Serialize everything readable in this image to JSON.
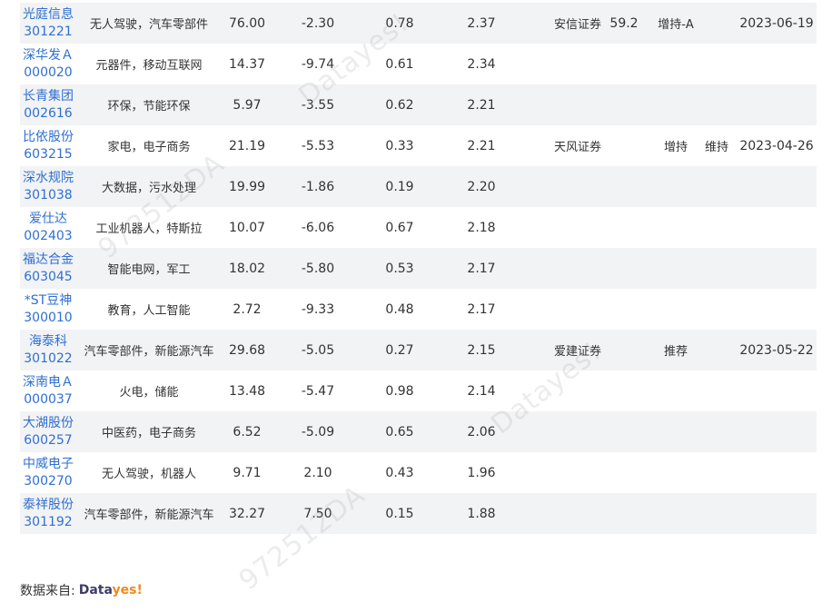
{
  "rows": [
    {
      "name": "光庭信息",
      "code": "301221",
      "industry": "无人驾驶，汽车零部件",
      "price": "76.00",
      "change": "-2.30",
      "turnover": "0.78",
      "vol_ratio": "2.37",
      "institution": "安信证券",
      "score": "59.2",
      "rating": "增持-A",
      "action": "",
      "date": "2023-06-19"
    },
    {
      "name": "深华发Ａ",
      "code": "000020",
      "industry": "元器件，移动互联网",
      "price": "14.37",
      "change": "-9.74",
      "turnover": "0.61",
      "vol_ratio": "2.34",
      "institution": "",
      "score": "",
      "rating": "",
      "action": "",
      "date": ""
    },
    {
      "name": "长青集团",
      "code": "002616",
      "industry": "环保，节能环保",
      "price": "5.97",
      "change": "-3.55",
      "turnover": "0.62",
      "vol_ratio": "2.21",
      "institution": "",
      "score": "",
      "rating": "",
      "action": "",
      "date": ""
    },
    {
      "name": "比依股份",
      "code": "603215",
      "industry": "家电，电子商务",
      "price": "21.19",
      "change": "-5.53",
      "turnover": "0.33",
      "vol_ratio": "2.21",
      "institution": "天风证券",
      "score": "",
      "rating": "增持",
      "action": "维持",
      "date": "2023-04-26"
    },
    {
      "name": "深水规院",
      "code": "301038",
      "industry": "大数据，污水处理",
      "price": "19.99",
      "change": "-1.86",
      "turnover": "0.19",
      "vol_ratio": "2.20",
      "institution": "",
      "score": "",
      "rating": "",
      "action": "",
      "date": ""
    },
    {
      "name": "爱仕达",
      "code": "002403",
      "industry": "工业机器人，特斯拉",
      "price": "10.07",
      "change": "-6.06",
      "turnover": "0.67",
      "vol_ratio": "2.18",
      "institution": "",
      "score": "",
      "rating": "",
      "action": "",
      "date": ""
    },
    {
      "name": "福达合金",
      "code": "603045",
      "industry": "智能电网，军工",
      "price": "18.02",
      "change": "-5.80",
      "turnover": "0.53",
      "vol_ratio": "2.17",
      "institution": "",
      "score": "",
      "rating": "",
      "action": "",
      "date": ""
    },
    {
      "name": "*ST豆神",
      "code": "300010",
      "industry": "教育，人工智能",
      "price": "2.72",
      "change": "-9.33",
      "turnover": "0.48",
      "vol_ratio": "2.17",
      "institution": "",
      "score": "",
      "rating": "",
      "action": "",
      "date": ""
    },
    {
      "name": "海泰科",
      "code": "301022",
      "industry": "汽车零部件，新能源汽车",
      "price": "29.68",
      "change": "-5.05",
      "turnover": "0.27",
      "vol_ratio": "2.15",
      "institution": "爱建证券",
      "score": "",
      "rating": "推荐",
      "action": "",
      "date": "2023-05-22"
    },
    {
      "name": "深南电Ａ",
      "code": "000037",
      "industry": "火电，储能",
      "price": "13.48",
      "change": "-5.47",
      "turnover": "0.98",
      "vol_ratio": "2.14",
      "institution": "",
      "score": "",
      "rating": "",
      "action": "",
      "date": ""
    },
    {
      "name": "大湖股份",
      "code": "600257",
      "industry": "中医药，电子商务",
      "price": "6.52",
      "change": "-5.09",
      "turnover": "0.65",
      "vol_ratio": "2.06",
      "institution": "",
      "score": "",
      "rating": "",
      "action": "",
      "date": ""
    },
    {
      "name": "中威电子",
      "code": "300270",
      "industry": "无人驾驶，机器人",
      "price": "9.71",
      "change": "2.10",
      "turnover": "0.43",
      "vol_ratio": "1.96",
      "institution": "",
      "score": "",
      "rating": "",
      "action": "",
      "date": ""
    },
    {
      "name": "泰祥股份",
      "code": "301192",
      "industry": "汽车零部件，新能源汽车",
      "price": "32.27",
      "change": "7.50",
      "turnover": "0.15",
      "vol_ratio": "1.88",
      "institution": "",
      "score": "",
      "rating": "",
      "action": "",
      "date": ""
    }
  ],
  "watermarks": [
    "Datayes!",
    "972512DA",
    "Datayes!",
    "Datayes!",
    "972512DA"
  ],
  "footer": {
    "source_label": "数据来自:",
    "logo_part1": "Data",
    "logo_part2": "yes!"
  },
  "colors": {
    "link": "#2f6fd1",
    "stripe": "#f2f3f5",
    "logo_dark": "#3d3d6b",
    "logo_orange": "#f08a1c"
  }
}
